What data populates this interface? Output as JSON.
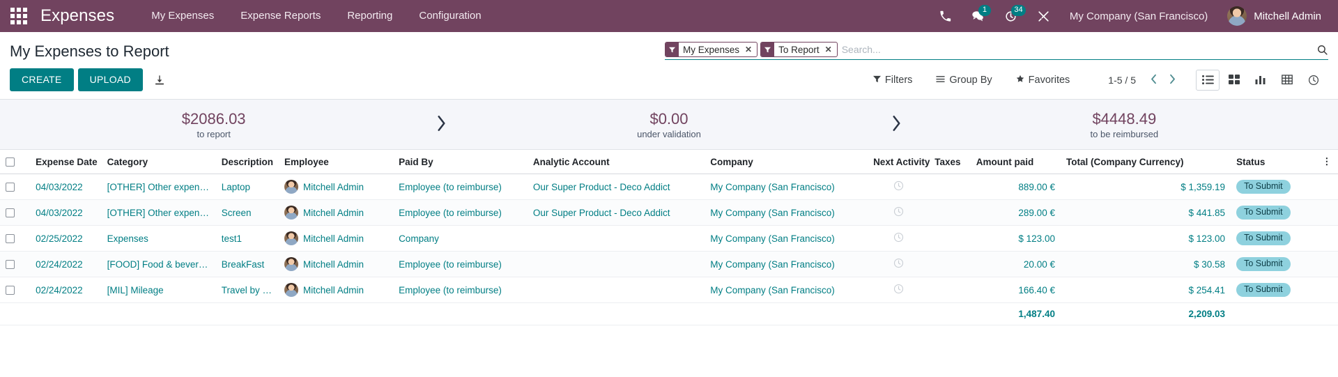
{
  "navbar": {
    "apps_icon": "apps-grid-icon",
    "brand": "Expenses",
    "menu": [
      {
        "label": "My Expenses"
      },
      {
        "label": "Expense Reports"
      },
      {
        "label": "Reporting"
      },
      {
        "label": "Configuration"
      }
    ],
    "icons": {
      "phone": "phone-icon",
      "messages": "messages-icon",
      "activities": "activities-clock-icon",
      "debug": "debug-tools-icon"
    },
    "messages_badge": "1",
    "activities_badge": "34",
    "company": "My Company (San Francisco)",
    "user": "Mitchell Admin"
  },
  "control_panel": {
    "title": "My Expenses to Report",
    "create_label": "CREATE",
    "upload_label": "UPLOAD",
    "download_icon": "download-icon",
    "facets": [
      {
        "label": "My Expenses",
        "icon": "filter-icon",
        "close": "✕"
      },
      {
        "label": "To Report",
        "icon": "filter-icon",
        "close": "✕"
      }
    ],
    "search_placeholder": "Search...",
    "search_value": "",
    "search_icon": "search-icon",
    "filters_label": "Filters",
    "groupby_label": "Group By",
    "favorites_label": "Favorites",
    "pager": "1-5 / 5",
    "views": [
      {
        "name": "list-view",
        "active": true
      },
      {
        "name": "kanban-view",
        "active": false
      },
      {
        "name": "graph-view",
        "active": false
      },
      {
        "name": "pivot-view",
        "active": false
      },
      {
        "name": "activity-view",
        "active": false
      }
    ]
  },
  "summary": [
    {
      "amount": "$2086.03",
      "label": "to report"
    },
    {
      "amount": "$0.00",
      "label": "under validation"
    },
    {
      "amount": "$4448.49",
      "label": "to be reimbursed"
    }
  ],
  "table": {
    "headers": {
      "expense_date": "Expense Date",
      "category": "Category",
      "description": "Description",
      "employee": "Employee",
      "paid_by": "Paid By",
      "analytic_account": "Analytic Account",
      "company": "Company",
      "next_activity": "Next Activity",
      "taxes": "Taxes",
      "amount_paid": "Amount paid",
      "total": "Total (Company Currency)",
      "status": "Status",
      "options_icon": "kebab-menu-icon"
    },
    "rows": [
      {
        "date": "04/03/2022",
        "category": "[OTHER] Other expenses",
        "description": "Laptop",
        "employee": "Mitchell Admin",
        "paid_by": "Employee (to reimburse)",
        "analytic_account": "Our Super Product - Deco Addict",
        "company": "My Company (San Francisco)",
        "taxes": "",
        "amount_paid": "889.00 €",
        "total": "$ 1,359.19",
        "status": "To Submit"
      },
      {
        "date": "04/03/2022",
        "category": "[OTHER] Other expenses",
        "description": "Screen",
        "employee": "Mitchell Admin",
        "paid_by": "Employee (to reimburse)",
        "analytic_account": "Our Super Product - Deco Addict",
        "company": "My Company (San Francisco)",
        "taxes": "",
        "amount_paid": "289.00 €",
        "total": "$ 441.85",
        "status": "To Submit"
      },
      {
        "date": "02/25/2022",
        "category": "Expenses",
        "description": "test1",
        "employee": "Mitchell Admin",
        "paid_by": "Company",
        "analytic_account": "",
        "company": "My Company (San Francisco)",
        "taxes": "",
        "amount_paid": "$ 123.00",
        "total": "$ 123.00",
        "status": "To Submit"
      },
      {
        "date": "02/24/2022",
        "category": "[FOOD] Food & beverages",
        "description": "BreakFast",
        "employee": "Mitchell Admin",
        "paid_by": "Employee (to reimburse)",
        "analytic_account": "",
        "company": "My Company (San Francisco)",
        "taxes": "",
        "amount_paid": "20.00 €",
        "total": "$ 30.58",
        "status": "To Submit"
      },
      {
        "date": "02/24/2022",
        "category": "[MIL] Mileage",
        "description": "Travel by car",
        "employee": "Mitchell Admin",
        "paid_by": "Employee (to reimburse)",
        "analytic_account": "",
        "company": "My Company (San Francisco)",
        "taxes": "",
        "amount_paid": "166.40 €",
        "total": "$ 254.41",
        "status": "To Submit"
      }
    ],
    "footer": {
      "amount_paid_total": "1,487.40",
      "total_total": "2,209.03"
    }
  },
  "colors": {
    "brand_purple": "#71435f",
    "accent_teal": "#017e84",
    "status_badge": "#8ed1de",
    "summary_bg": "#f5f6fa"
  }
}
